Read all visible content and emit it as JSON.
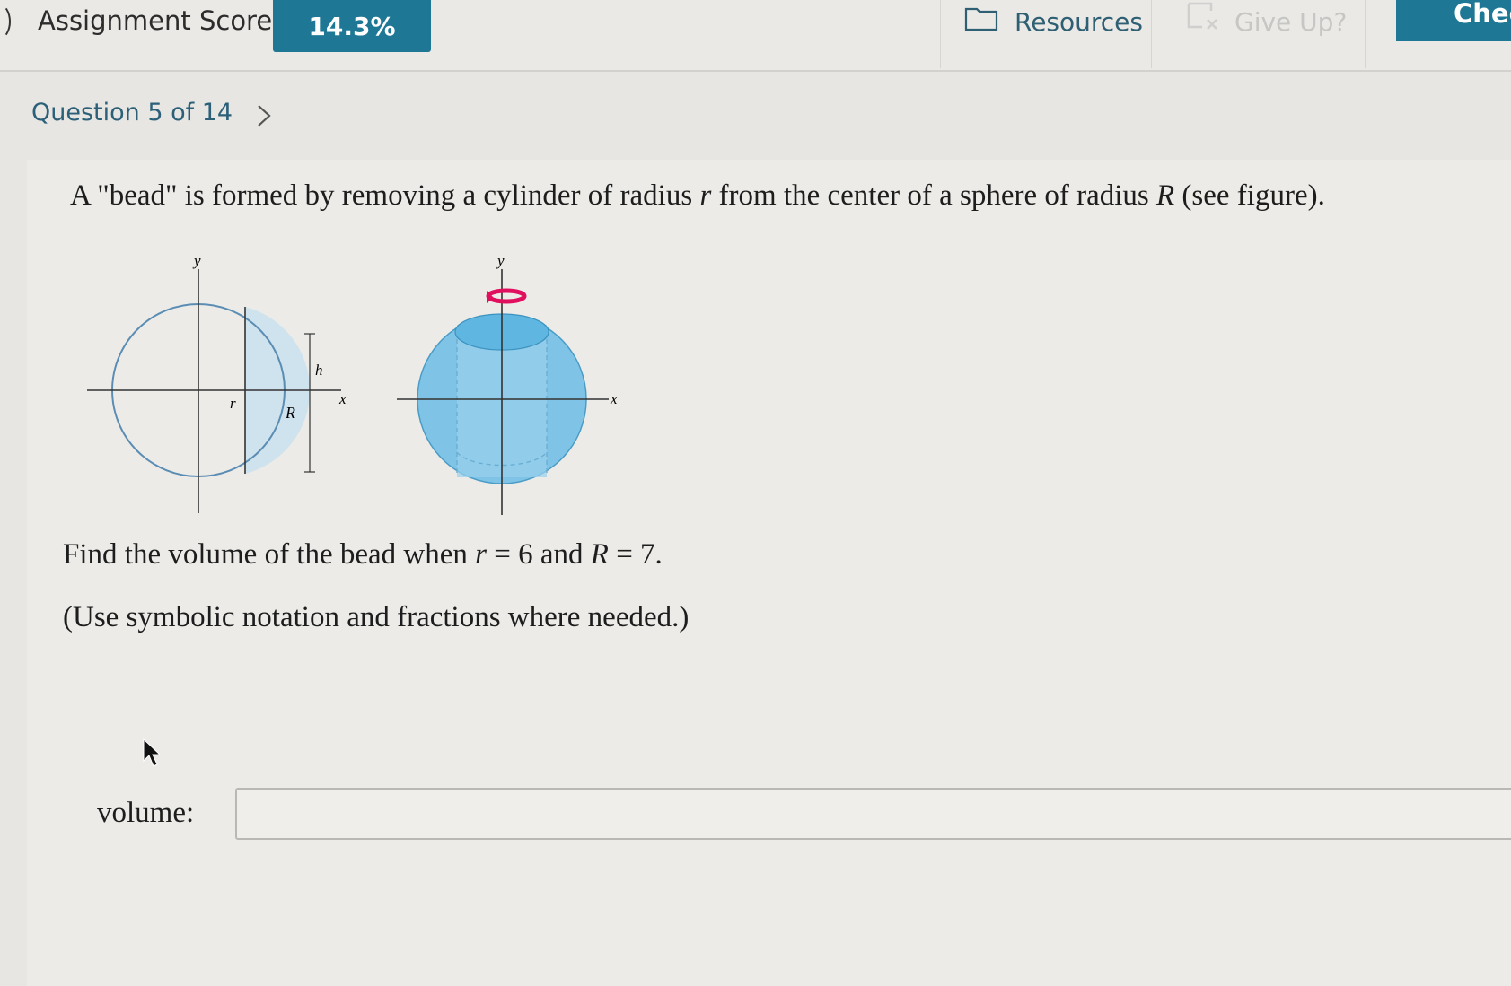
{
  "header": {
    "score_label": "Assignment Score:",
    "score_value": "14.3%",
    "resources_label": "Resources",
    "giveup_label": "Give Up?",
    "check_label": "Chec"
  },
  "question_nav": {
    "label": "Question 5 of 14"
  },
  "question": {
    "prompt_pre": "A \"bead\" is formed by removing a cylinder of radius ",
    "prompt_r": "r",
    "prompt_mid": " from the center of a sphere of radius ",
    "prompt_R": "R",
    "prompt_post": " (see figure).",
    "find_pre": "Find the volume of the bead when ",
    "find_r": "r",
    "find_eq1": " = 6 and ",
    "find_R": "R",
    "find_eq2": " = 7.",
    "note": "(Use symbolic notation and fractions where needed.)"
  },
  "figure": {
    "left_labels": {
      "y": "y",
      "x": "x",
      "h": "h",
      "r": "r",
      "R": "R"
    },
    "right_labels": {
      "y": "y",
      "x": "x"
    }
  },
  "answer": {
    "label": "volume:",
    "value": "",
    "placeholder": ""
  },
  "icons": [
    "folder-icon",
    "give-up-icon",
    "chevron-right-icon",
    "rotation-arrow-icon",
    "mouse-cursor-icon"
  ],
  "colors": {
    "accent": "#1e7895",
    "link": "#2c6079",
    "shade": "#7fc4e6",
    "rotation": "#e0105e"
  }
}
